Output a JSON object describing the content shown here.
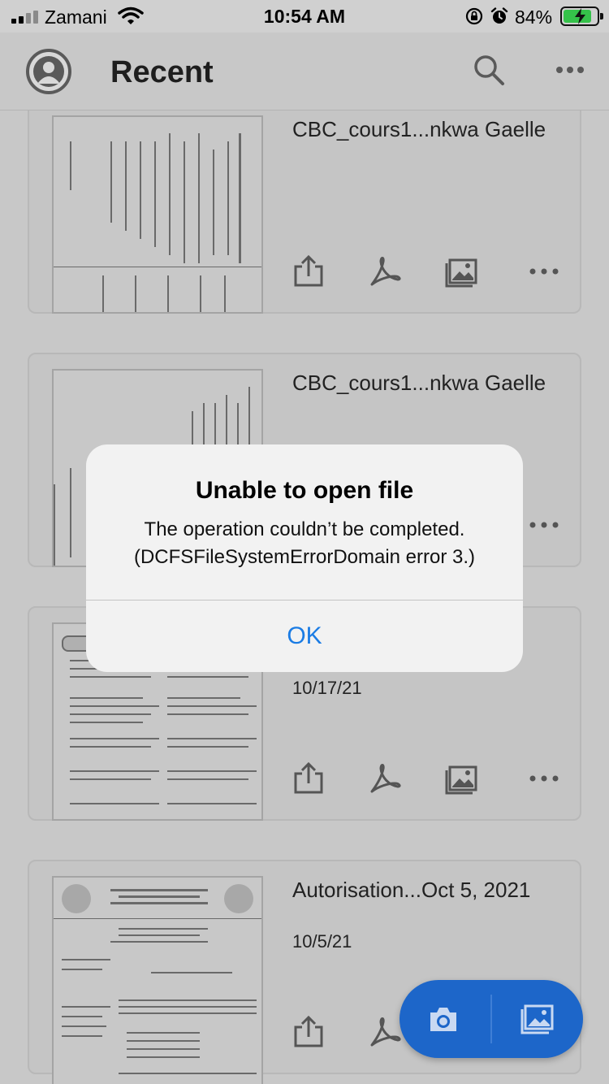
{
  "status_bar": {
    "carrier": "Zamani",
    "time": "10:54 AM",
    "battery_percent": "84%",
    "battery_level": 0.84,
    "icons": [
      "signal-icon",
      "wifi-icon",
      "orientation-lock-icon",
      "alarm-icon",
      "battery-charging-icon"
    ]
  },
  "header": {
    "title": "Recent",
    "icons": [
      "profile-avatar-icon",
      "search-icon",
      "more-icon"
    ]
  },
  "documents": [
    {
      "title": "CBC_cours1...nkwa Gaelle",
      "date": ""
    },
    {
      "title": "CBC_cours1...nkwa Gaelle",
      "date": ""
    },
    {
      "title": "",
      "date": "10/17/21"
    },
    {
      "title": "Autorisation...Oct 5, 2021",
      "date": "10/5/21"
    }
  ],
  "card_actions": [
    "share-icon",
    "acrobat-icon",
    "image-icon",
    "more-icon"
  ],
  "dialog": {
    "title": "Unable to open file",
    "message": "The operation couldn’t be completed. (DCFSFileSystemErrorDomain error 3.)",
    "button": "OK"
  },
  "fab": {
    "icons": [
      "camera-icon",
      "gallery-icon"
    ]
  },
  "colors": {
    "accent": "#1d66c9",
    "dialog_button": "#1b7ce4",
    "battery_fill": "#35c24a"
  }
}
